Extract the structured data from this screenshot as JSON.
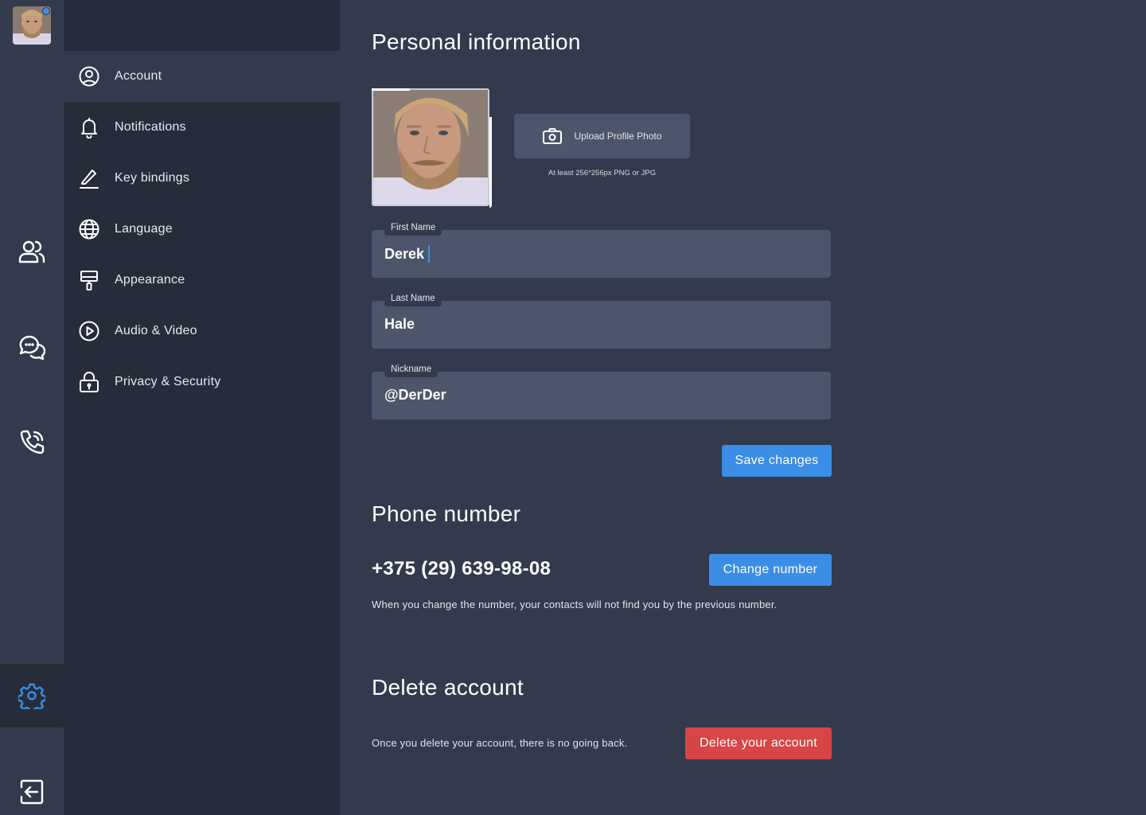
{
  "rail": {
    "avatar_alt": "User avatar",
    "status_color": "#3b8ef0",
    "items": [
      {
        "icon": "contacts-icon"
      },
      {
        "icon": "chats-icon"
      },
      {
        "icon": "calls-icon"
      },
      {
        "icon": "settings-icon",
        "active": true
      },
      {
        "icon": "logout-icon"
      }
    ]
  },
  "menu": {
    "items": [
      {
        "label": "Account",
        "icon": "account-icon",
        "active": true
      },
      {
        "label": "Notifications",
        "icon": "bell-icon"
      },
      {
        "label": "Key bindings",
        "icon": "pen-icon"
      },
      {
        "label": "Language",
        "icon": "globe-icon"
      },
      {
        "label": "Appearance",
        "icon": "paint-roller-icon"
      },
      {
        "label": "Audio & Video",
        "icon": "play-icon"
      },
      {
        "label": "Privacy & Security",
        "icon": "lock-icon"
      }
    ]
  },
  "personal": {
    "title": "Personal information",
    "upload_label": "Upload Profile Photo",
    "upload_hint": "At least 256*256px PNG or JPG",
    "first_name": {
      "label": "First Name",
      "value": "Derek"
    },
    "last_name": {
      "label": "Last Name",
      "value": "Hale"
    },
    "nickname": {
      "label": "Nickname",
      "value": "@DerDer"
    },
    "save_label": "Save changes"
  },
  "phone": {
    "title": "Phone number",
    "number": "+375 (29) 639-98-08",
    "change_label": "Change number",
    "note": "When you change the number, your contacts will not find you by the previous number."
  },
  "delete": {
    "title": "Delete account",
    "note": "Once you delete your account, there is no going back.",
    "button_label": "Delete your account"
  },
  "colors": {
    "accent": "#3b8ee6",
    "danger": "#d84545",
    "sidebar": "#262c3a",
    "background": "#333a4d",
    "field": "#4c5569"
  }
}
